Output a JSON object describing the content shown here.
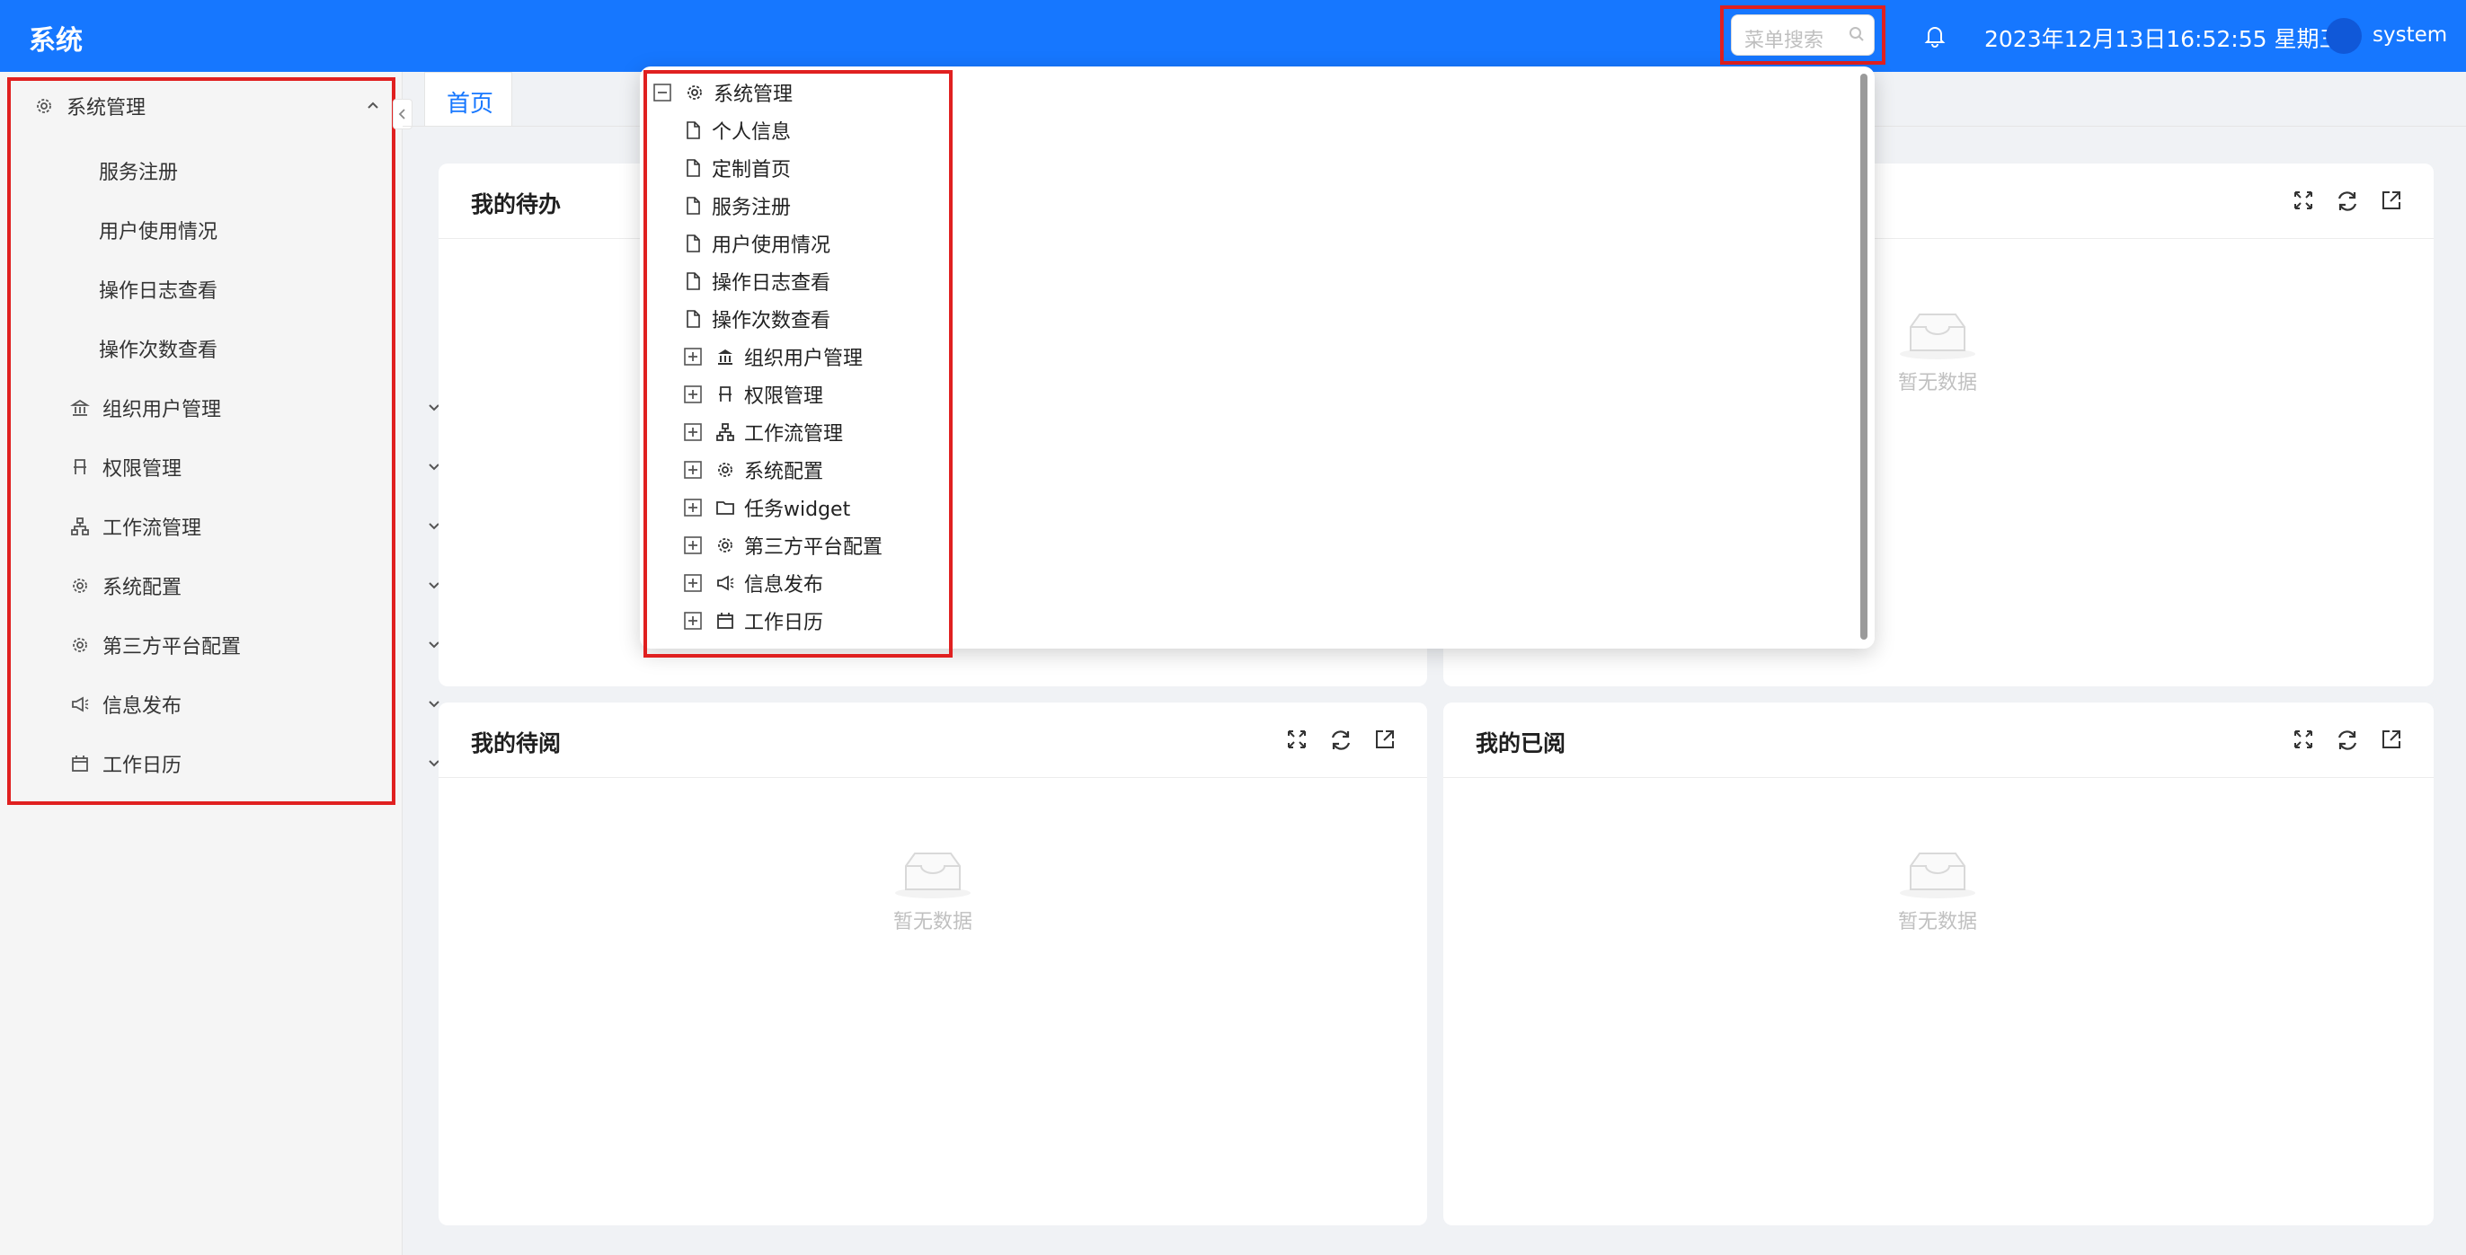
{
  "app": {
    "title": "系统"
  },
  "header": {
    "search_placeholder": "菜单搜索",
    "datetime": "2023年12月13日16:52:55 星期三",
    "username": "system"
  },
  "sidebar": {
    "items": [
      {
        "label": "系统管理",
        "icon": "gear-icon",
        "expanded": true
      },
      {
        "label": "服务注册"
      },
      {
        "label": "用户使用情况"
      },
      {
        "label": "操作日志查看"
      },
      {
        "label": "操作次数查看"
      },
      {
        "label": "组织用户管理",
        "icon": "bank-icon"
      },
      {
        "label": "权限管理",
        "icon": "seat-icon"
      },
      {
        "label": "工作流管理",
        "icon": "org-tree-icon"
      },
      {
        "label": "系统配置",
        "icon": "gear-icon"
      },
      {
        "label": "第三方平台配置",
        "icon": "gear-icon"
      },
      {
        "label": "信息发布",
        "icon": "megaphone-icon"
      },
      {
        "label": "工作日历",
        "icon": "calendar-icon"
      }
    ]
  },
  "tabs": [
    {
      "label": "首页",
      "active": true
    }
  ],
  "cards": [
    {
      "title": "我的待办",
      "empty_text": "暂无数据"
    },
    {
      "title": "",
      "empty_text": "暂无数据"
    },
    {
      "title": "我的待阅",
      "empty_text": "暂无数据"
    },
    {
      "title": "我的已阅",
      "empty_text": "暂无数据"
    }
  ],
  "menu_tree": {
    "root": {
      "label": "系统管理",
      "icon": "gear-icon",
      "expanded": true
    },
    "leaves": [
      "个人信息",
      "定制首页",
      "服务注册",
      "用户使用情况",
      "操作日志查看",
      "操作次数查看"
    ],
    "groups": [
      {
        "label": "组织用户管理",
        "icon": "bank-icon"
      },
      {
        "label": "权限管理",
        "icon": "seat-icon"
      },
      {
        "label": "工作流管理",
        "icon": "org-tree-icon"
      },
      {
        "label": "系统配置",
        "icon": "gear-icon"
      },
      {
        "label": "任务widget",
        "icon": "folder-icon"
      },
      {
        "label": "第三方平台配置",
        "icon": "gear-icon"
      },
      {
        "label": "信息发布",
        "icon": "megaphone-icon"
      },
      {
        "label": "工作日历",
        "icon": "calendar-icon"
      }
    ]
  },
  "colors": {
    "primary": "#1677ff",
    "highlight": "#e02020",
    "background": "#f0f2f5"
  }
}
